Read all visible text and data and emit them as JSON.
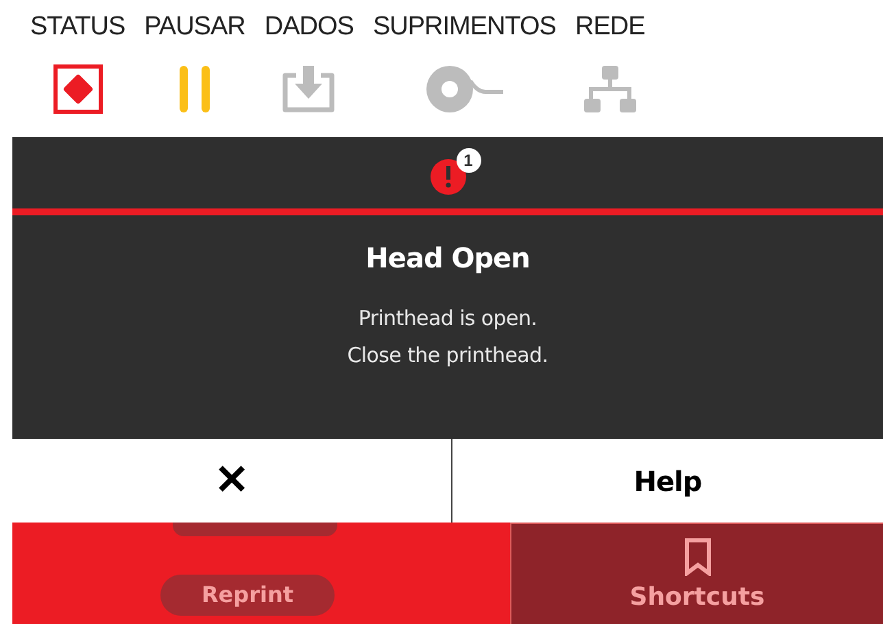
{
  "status_tabs": [
    {
      "label": "STATUS",
      "kind": "status",
      "color": "#ec1c24"
    },
    {
      "label": "PAUSAR",
      "kind": "pause",
      "color": "#fbbf17"
    },
    {
      "label": "DADOS",
      "kind": "data",
      "color": "#bcbcbc"
    },
    {
      "label": "SUPRIMENTOS",
      "kind": "supplies",
      "color": "#bcbcbc"
    },
    {
      "label": "REDE",
      "kind": "network",
      "color": "#bcbcbc"
    }
  ],
  "alert": {
    "count": "1",
    "title": "Head Open",
    "messages": [
      "Printhead is open.",
      "Close the printhead."
    ]
  },
  "dialog_buttons": [
    {
      "kind": "close",
      "label": "✕"
    },
    {
      "kind": "text",
      "label": "Help"
    }
  ],
  "bottom": {
    "reprint": "Reprint",
    "shortcuts": "Shortcuts"
  }
}
